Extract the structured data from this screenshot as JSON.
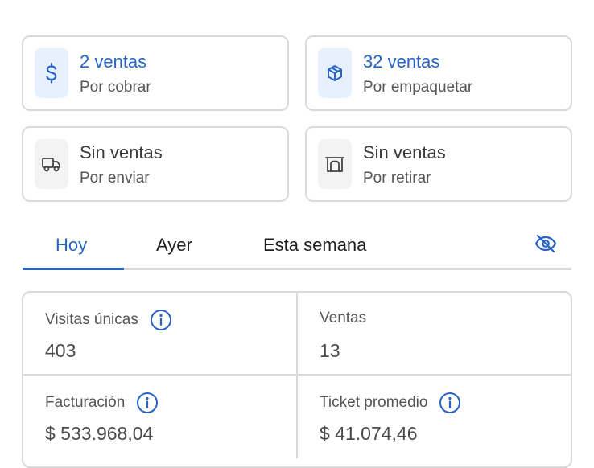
{
  "cards": [
    {
      "title": "2 ventas",
      "subtitle": "Por cobrar",
      "icon": "dollar-icon"
    },
    {
      "title": "32 ventas",
      "subtitle": "Por empaquetar",
      "icon": "package-icon"
    },
    {
      "title": "Sin ventas",
      "subtitle": "Por enviar",
      "icon": "truck-icon"
    },
    {
      "title": "Sin ventas",
      "subtitle": "Por retirar",
      "icon": "store-icon"
    }
  ],
  "tabs": {
    "items": [
      "Hoy",
      "Ayer",
      "Esta semana"
    ],
    "active": "Hoy",
    "visibility_icon": "eye-off-icon"
  },
  "metrics": {
    "unique_visits": {
      "label": "Visitas únicas",
      "value": "403"
    },
    "sales": {
      "label": "Ventas",
      "value": "13"
    },
    "billing": {
      "label": "Facturación",
      "value": "$ 533.968,04"
    },
    "avg_ticket": {
      "label": "Ticket promedio",
      "value": "$ 41.074,46"
    }
  },
  "colors": {
    "accent": "#2563c7",
    "border": "#d9d9d9",
    "icon_bg_blue": "#e8f0fe",
    "icon_bg_grey": "#f3f3f3"
  }
}
